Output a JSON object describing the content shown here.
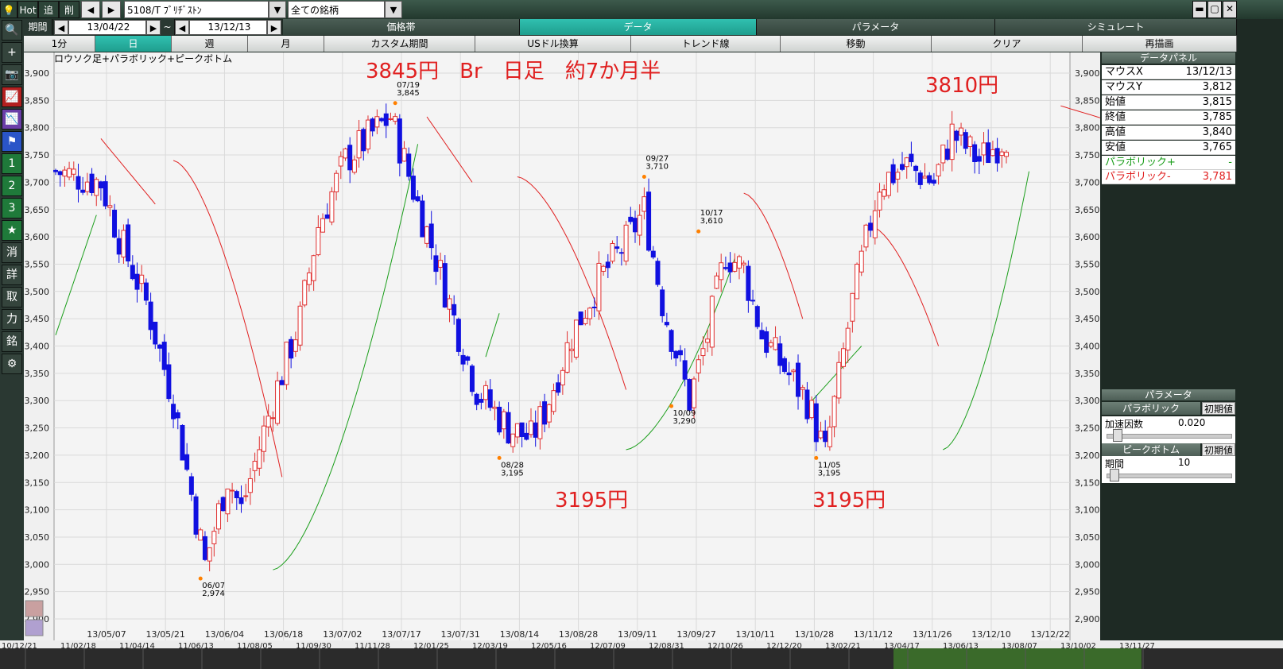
{
  "topbar": {
    "hot": "Hot",
    "add": "追",
    "del": "削",
    "symbol": "5108/T ﾌﾞﾘﾁﾞｽﾄﾝ",
    "group": "全ての銘柄"
  },
  "row2": {
    "period_label": "期間",
    "from": "13/04/22",
    "tilde": "~",
    "to": "13/12/13",
    "tabs": [
      "価格帯",
      "データ",
      "パラメータ",
      "シミュレート"
    ],
    "active_tab": "データ"
  },
  "row3": {
    "items": [
      "1分",
      "日",
      "週",
      "月",
      "カスタム期間",
      "USドル換算",
      "トレンド線",
      "移動",
      "クリア",
      "再描画"
    ],
    "active": "日"
  },
  "sidebar": {
    "buttons": [
      {
        "icon": "search-icon",
        "glyph": "🔍"
      },
      {
        "icon": "crosshair-icon",
        "glyph": "+"
      },
      {
        "icon": "camera-icon",
        "glyph": "📷"
      },
      {
        "icon": "line-chart-icon",
        "glyph": "📈"
      },
      {
        "icon": "indicator-icon",
        "glyph": "📉"
      },
      {
        "icon": "flag-icon",
        "glyph": "⚑"
      },
      {
        "icon": "slot-1-icon",
        "glyph": "1"
      },
      {
        "icon": "slot-2-icon",
        "glyph": "2"
      },
      {
        "icon": "slot-3-icon",
        "glyph": "3"
      },
      {
        "icon": "star-icon",
        "glyph": "★"
      },
      {
        "icon": "erase-icon",
        "glyph": "消"
      },
      {
        "icon": "detail-icon",
        "glyph": "詳"
      },
      {
        "icon": "take-icon",
        "glyph": "取"
      },
      {
        "icon": "power-icon",
        "glyph": "力"
      },
      {
        "icon": "stock-icon",
        "glyph": "銘"
      },
      {
        "icon": "gear-icon",
        "glyph": "⚙"
      }
    ]
  },
  "chart": {
    "legend": "ロウソク足+パラボリック+ピークボトム",
    "title_annotation": "3845円　Br　日足　約7か月半",
    "annotations": [
      {
        "text": "3810円"
      },
      {
        "text": "3195円"
      },
      {
        "text": "3195円"
      }
    ],
    "peaks": [
      {
        "date": "07/19",
        "value": "3,845"
      },
      {
        "date": "06/07",
        "value": "2,974"
      },
      {
        "date": "08/28",
        "value": "3,195"
      },
      {
        "date": "09/27",
        "value": "3,710"
      },
      {
        "date": "10/09",
        "value": "3,290"
      },
      {
        "date": "10/17",
        "value": "3,610"
      },
      {
        "date": "11/05",
        "value": "3,195"
      }
    ]
  },
  "chart_data": {
    "type": "candlestick",
    "ylim": [
      2900,
      3900
    ],
    "yticks": [
      "3,900",
      "3,850",
      "3,800",
      "3,750",
      "3,700",
      "3,650",
      "3,600",
      "3,550",
      "3,500",
      "3,450",
      "3,400",
      "3,350",
      "3,300",
      "3,250",
      "3,200",
      "3,150",
      "3,100",
      "3,050",
      "3,000",
      "2,950",
      "2,900"
    ],
    "xticks": [
      "13/05/07",
      "13/05/21",
      "13/06/04",
      "13/06/18",
      "13/07/02",
      "13/07/17",
      "13/07/31",
      "13/08/14",
      "13/08/28",
      "13/09/11",
      "13/09/27",
      "13/10/11",
      "13/10/28",
      "13/11/12",
      "13/11/26",
      "13/12/10",
      "13/12/22"
    ],
    "parabolic_up_color": "#1a9e1a",
    "parabolic_down_color": "#e02020",
    "up_candle_color": "#e03030",
    "down_candle_color": "#1010e0"
  },
  "panel": {
    "data_title": "データパネル",
    "rows": [
      {
        "k": "マウスX",
        "v": "13/12/13"
      },
      {
        "k": "マウスY",
        "v": "3,812"
      },
      {
        "k": "始値",
        "v": "3,815"
      },
      {
        "k": "終値",
        "v": "3,785"
      },
      {
        "k": "高値",
        "v": "3,840"
      },
      {
        "k": "安値",
        "v": "3,765"
      }
    ],
    "para_plus_label": "パラボリック+",
    "para_plus_value": "-",
    "para_minus_label": "パラボリック-",
    "para_minus_value": "3,781",
    "param_title": "パラメータ",
    "parabolic_label": "パラボリック",
    "init_label": "初期値",
    "accel_label": "加速因数",
    "accel_value": "0.020",
    "peakbottom_label": "ピークボトム",
    "init_label2": "初期値",
    "period_label": "期間",
    "period_value": "10"
  },
  "bottom": {
    "dates": [
      "10/12/21",
      "11/02/18",
      "11/04/14",
      "11/06/13",
      "11/08/05",
      "11/09/30",
      "11/11/28",
      "12/01/25",
      "12/03/19",
      "12/05/16",
      "12/07/09",
      "12/08/31",
      "12/10/26",
      "12/12/20",
      "13/02/21",
      "13/04/17",
      "13/06/13",
      "13/08/07",
      "13/10/02",
      "13/11/27"
    ]
  }
}
